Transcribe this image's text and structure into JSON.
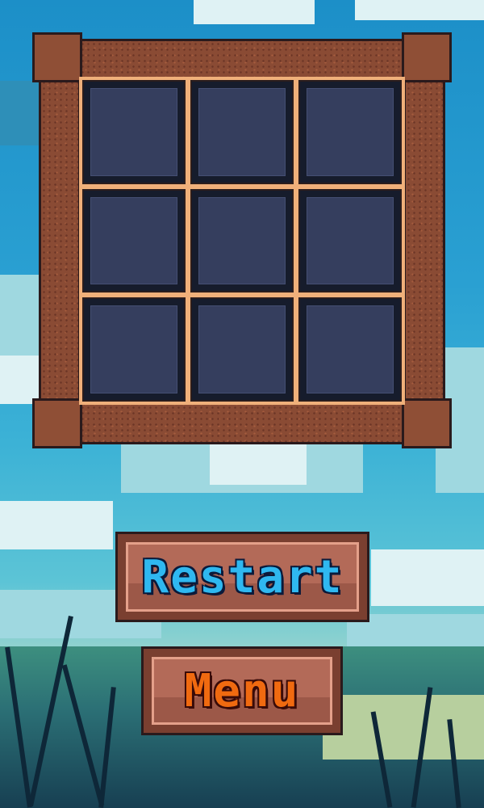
{
  "board": {
    "rows": 3,
    "cols": 3,
    "cells": [
      "",
      "",
      "",
      "",
      "",
      "",
      "",
      "",
      ""
    ]
  },
  "buttons": {
    "restart_label": "Restart",
    "menu_label": "Menu"
  },
  "colors": {
    "frame_wood": "#8a4b34",
    "cell_fill": "#353e5e",
    "restart_text": "#2fb8f0",
    "menu_text": "#f06a10",
    "sky": "#2aa0d2"
  }
}
